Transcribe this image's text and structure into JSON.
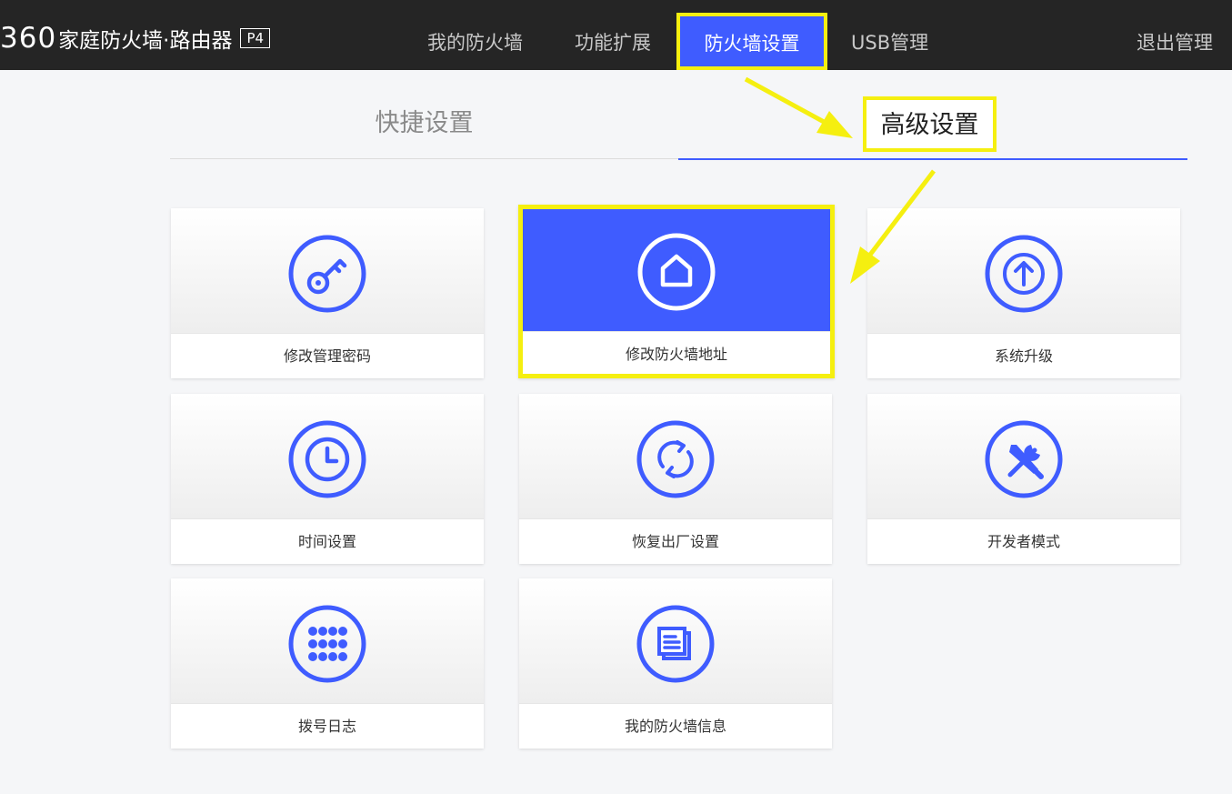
{
  "header": {
    "logo_number": "360",
    "logo_text": "家庭防火墙·路由器",
    "logo_badge": "P4",
    "nav": [
      {
        "label": "我的防火墙"
      },
      {
        "label": "功能扩展"
      },
      {
        "label": "防火墙设置",
        "active": true
      },
      {
        "label": "USB管理"
      }
    ],
    "logout_label": "退出管理"
  },
  "tabs": {
    "quick_label": "快捷设置",
    "advanced_label": "高级设置",
    "active": "advanced"
  },
  "cards": [
    {
      "label": "修改管理密码",
      "icon": "key-icon"
    },
    {
      "label": "修改防火墙地址",
      "icon": "home-icon",
      "selected": true
    },
    {
      "label": "系统升级",
      "icon": "upload-arrow-icon"
    },
    {
      "label": "时间设置",
      "icon": "clock-icon"
    },
    {
      "label": "恢复出厂设置",
      "icon": "refresh-icon"
    },
    {
      "label": "开发者模式",
      "icon": "tools-icon"
    },
    {
      "label": "拨号日志",
      "icon": "grid-dots-icon"
    },
    {
      "label": "我的防火墙信息",
      "icon": "document-icon"
    }
  ],
  "colors": {
    "accent": "#3f5cff",
    "highlight": "#f5ef10",
    "topbar": "#252525"
  }
}
